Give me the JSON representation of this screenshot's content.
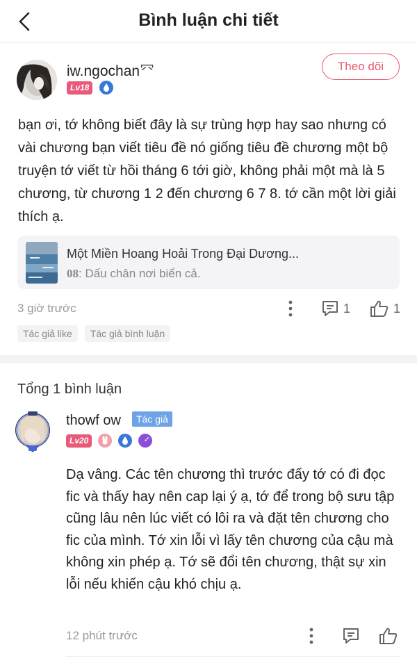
{
  "header": {
    "title": "Bình luận chi tiết"
  },
  "post": {
    "username": "iw.ngochan",
    "username_suffix": "⺳",
    "level": "Lv18",
    "follow_label": "Theo dõi",
    "text": "bạn ơi, tớ không biết đây là sự trùng hợp hay  sao nhưng có vài chương bạn viết tiêu đề nó giống tiêu đề chương một bộ truyện tớ viết từ hồi tháng 6 tới giờ, không phải một mà là 5 chương, từ chương 1 2 đến chương 6 7 8. tớ cần một lời giải thích ạ.",
    "story": {
      "title": "Một Miền Hoang Hoải Trong Đại Dương...",
      "chapter_number": "08",
      "chapter_title": ": Dấu chân nơi biển cả."
    },
    "time": "3 giờ trước",
    "comment_count": "1",
    "like_count": "1",
    "tags": [
      "Tác giả like",
      "Tác giả bình luận"
    ]
  },
  "replies_header": "Tổng 1 bình luận",
  "reply": {
    "username": "thowf ow",
    "author_tag": "Tác giả",
    "level": "Lv20",
    "text": "Dạ vâng. Các tên chương thì trước đấy tớ có đi đọc fic và thấy hay nên cap lại ý ạ, tớ để trong bộ sưu tập cũng lâu nên lúc viết có lôi ra và đặt tên chương cho fic của mình. Tớ xin lỗi vì lấy tên chương của cậu mà không xin phép ạ. Tớ sẽ đổi tên chương, thật sự xin lỗi nếu khiến cậu khó chịu ạ.",
    "time": "12 phút trước"
  },
  "colors": {
    "accent_pink": "#e8576a",
    "level_badge": "#e85a7a",
    "author_tag": "#6ea3e8",
    "muted_text": "#999999"
  },
  "icons": [
    "back-arrow-icon",
    "more-vertical-icon",
    "comment-icon",
    "thumbs-up-icon",
    "water-drop-badge-icon",
    "rabbit-badge-icon",
    "rocket-badge-icon"
  ]
}
